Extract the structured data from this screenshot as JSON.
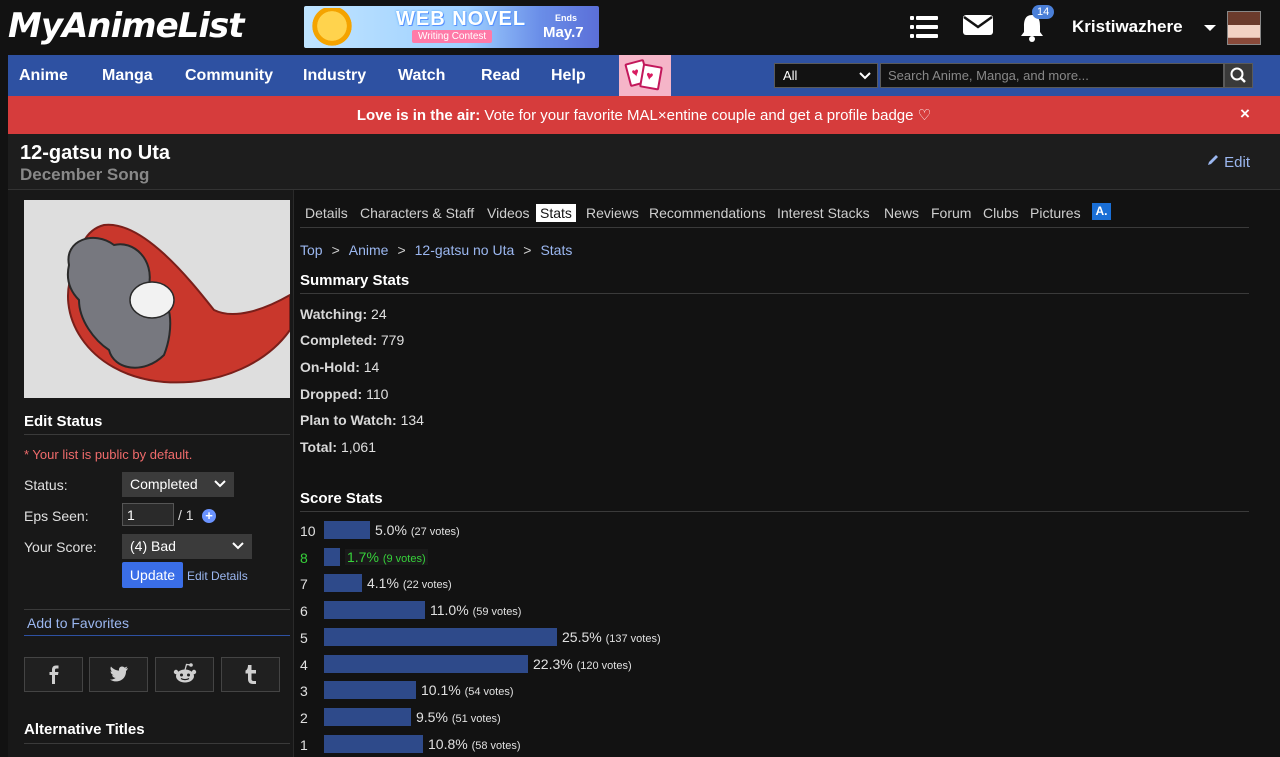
{
  "header": {
    "logo": "MyAnimeList",
    "banner": {
      "title": "WEB NOVEL",
      "subtitle": "Writing Contest",
      "ends_label": "Ends",
      "ends_date": "May.7"
    },
    "notifications_count": "14",
    "username": "Kristiwazhere"
  },
  "nav": {
    "items": [
      "Anime",
      "Manga",
      "Community",
      "Industry",
      "Watch",
      "Read",
      "Help"
    ],
    "search_scope": "All",
    "search_placeholder": "Search Anime, Manga, and more..."
  },
  "alert": {
    "bold": "Love is in the air:",
    "text": " Vote for your favorite MAL×entine couple and get a profile badge ♡",
    "close": "×"
  },
  "title": {
    "main": "12-gatsu no Uta",
    "english": "December Song",
    "edit": "Edit"
  },
  "edit_status": {
    "heading": "Edit Status",
    "note": "* Your list is public by default.",
    "status_label": "Status:",
    "status_value": "Completed",
    "eps_label": "Eps Seen:",
    "eps_value": "1",
    "eps_total": "/ 1",
    "score_label": "Your Score:",
    "score_value": "(4) Bad",
    "update": "Update",
    "edit_details": "Edit Details"
  },
  "favorites": "Add to Favorites",
  "share": [
    "f",
    "t",
    "r",
    "t"
  ],
  "alt_titles_heading": "Alternative Titles",
  "tabs": [
    "Details",
    "Characters & Staff",
    "Videos",
    "Stats",
    "Reviews",
    "Recommendations",
    "Interest Stacks",
    "News",
    "Forum",
    "Clubs",
    "Pictures"
  ],
  "tab_logo": "A.",
  "breadcrumb": [
    "Top",
    "Anime",
    "12-gatsu no Uta",
    "Stats"
  ],
  "summary": {
    "heading": "Summary Stats",
    "rows": [
      {
        "k": "Watching:",
        "v": "24"
      },
      {
        "k": "Completed:",
        "v": "779"
      },
      {
        "k": "On-Hold:",
        "v": "14"
      },
      {
        "k": "Dropped:",
        "v": "110"
      },
      {
        "k": "Plan to Watch:",
        "v": "134"
      },
      {
        "k": "Total:",
        "v": "1,061"
      }
    ]
  },
  "score_stats": {
    "heading": "Score Stats",
    "rows": [
      {
        "score": "10",
        "percent": 5.0,
        "pct": "5.0%",
        "votes": "(27 votes)",
        "highlight": false
      },
      {
        "score": "8",
        "percent": 1.7,
        "pct": "1.7%",
        "votes": "(9 votes)",
        "highlight": true
      },
      {
        "score": "7",
        "percent": 4.1,
        "pct": "4.1%",
        "votes": "(22 votes)",
        "highlight": false
      },
      {
        "score": "6",
        "percent": 11.0,
        "pct": "11.0%",
        "votes": "(59 votes)",
        "highlight": false
      },
      {
        "score": "5",
        "percent": 25.5,
        "pct": "25.5%",
        "votes": "(137 votes)",
        "highlight": false
      },
      {
        "score": "4",
        "percent": 22.3,
        "pct": "22.3%",
        "votes": "(120 votes)",
        "highlight": false
      },
      {
        "score": "3",
        "percent": 10.1,
        "pct": "10.1%",
        "votes": "(54 votes)",
        "highlight": false
      },
      {
        "score": "2",
        "percent": 9.5,
        "pct": "9.5%",
        "votes": "(51 votes)",
        "highlight": false
      },
      {
        "score": "1",
        "percent": 10.8,
        "pct": "10.8%",
        "votes": "(58 votes)",
        "highlight": false
      }
    ]
  }
}
